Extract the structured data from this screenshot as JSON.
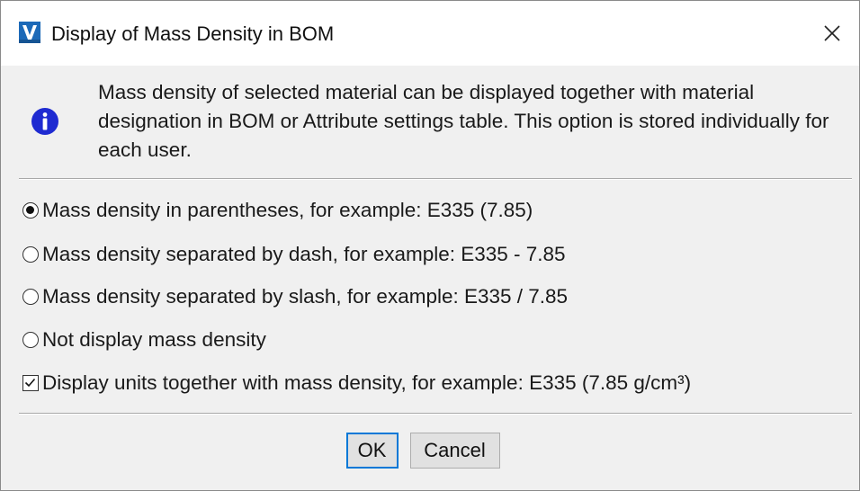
{
  "window": {
    "title": "Display of Mass Density in BOM",
    "close_glyph": "✕"
  },
  "info": {
    "icon": "info-icon",
    "message": "Mass density of selected material can be displayed together with material designation in BOM or Attribute settings table. This option is stored individually for each user."
  },
  "options": [
    {
      "label": "Mass density in parentheses, for example: E335 (7.85)",
      "selected": true
    },
    {
      "label": "Mass density separated by dash, for example: E335 - 7.85",
      "selected": false
    },
    {
      "label": "Mass density separated by slash, for example: E335 / 7.85",
      "selected": false
    },
    {
      "label": "Not display mass density",
      "selected": false
    }
  ],
  "units_checkbox": {
    "label": "Display units together with mass density, for example: E335 (7.85 g/cm³)",
    "checked": true
  },
  "buttons": {
    "ok_label": "OK",
    "cancel_label": "Cancel"
  },
  "colors": {
    "info_icon": "#1f2bd1",
    "default_button_border": "#0078d7",
    "logo": "#1c69b8"
  }
}
